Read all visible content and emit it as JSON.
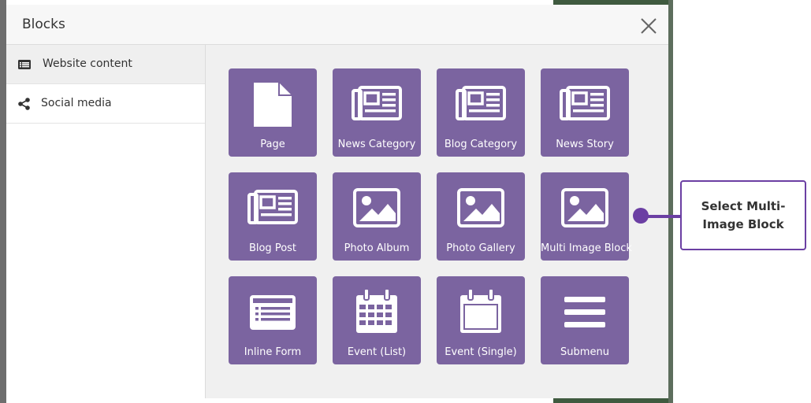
{
  "dialog": {
    "title": "Blocks",
    "close_icon": "close-icon"
  },
  "sidebar": {
    "items": [
      {
        "label": "Website content",
        "icon": "list-icon",
        "active": true
      },
      {
        "label": "Social media",
        "icon": "share-icon",
        "active": false
      }
    ]
  },
  "blocks": [
    {
      "label": "Page",
      "icon": "page-icon"
    },
    {
      "label": "News Category",
      "icon": "newspaper-icon"
    },
    {
      "label": "Blog Category",
      "icon": "newspaper-icon"
    },
    {
      "label": "News Story",
      "icon": "newspaper-icon"
    },
    {
      "label": "Blog Post",
      "icon": "newspaper-icon"
    },
    {
      "label": "Photo Album",
      "icon": "image-icon"
    },
    {
      "label": "Photo Gallery",
      "icon": "image-icon"
    },
    {
      "label": "Multi Image Block",
      "icon": "image-icon"
    },
    {
      "label": "Inline Form",
      "icon": "form-icon"
    },
    {
      "label": "Event (List)",
      "icon": "calendar-grid-icon"
    },
    {
      "label": "Event (Single)",
      "icon": "calendar-icon"
    },
    {
      "label": "Submenu",
      "icon": "menu-icon"
    }
  ],
  "callout": {
    "text": "Select Multi-Image Block"
  },
  "colors": {
    "tile": "#7b64a0",
    "callout": "#6b3fa3"
  }
}
